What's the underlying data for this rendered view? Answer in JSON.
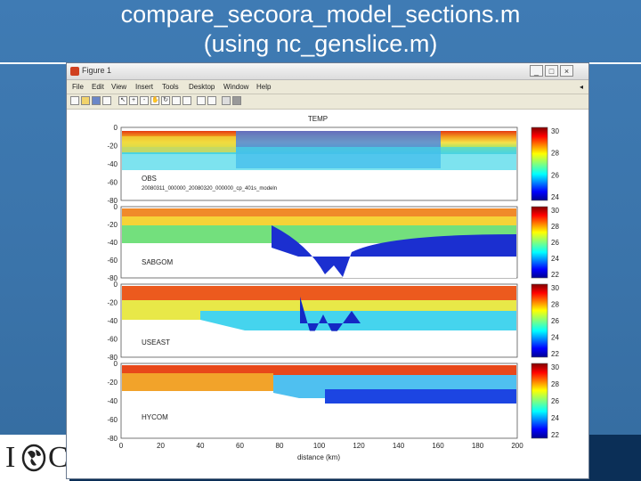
{
  "slide": {
    "title_line1": "compare_secoora_model_sections.m",
    "title_line2": "(using nc_genslice.m)"
  },
  "window": {
    "title": "Figure 1",
    "buttons": [
      "_",
      "□",
      "×"
    ]
  },
  "menu": [
    "File",
    "Edit",
    "View",
    "Insert",
    "Tools",
    "Desktop",
    "Window",
    "Help"
  ],
  "toolbar": [
    "new-icon",
    "open-icon",
    "save-icon",
    "print-icon",
    "pointer-icon",
    "zoom-in-icon",
    "zoom-out-icon",
    "pan-icon",
    "rotate-icon",
    "datacursor-icon",
    "brush-icon",
    "colorbar-icon",
    "legend-icon",
    "grid-icon",
    "plottools-icon"
  ],
  "figure": {
    "plot_title": "TEMP",
    "xlabel": "distance (km)",
    "x_ticks": [
      "0",
      "20",
      "40",
      "60",
      "80",
      "100",
      "120",
      "140",
      "160",
      "180",
      "200"
    ],
    "panels": [
      {
        "label_lines": [
          "OBS",
          "20080311_000000_20080320_000000_cp_401s_modeln"
        ],
        "y_ticks": [
          "0",
          "-20",
          "-40",
          "-60",
          "-80"
        ],
        "cbar_ticks": [
          "30",
          "28",
          "26",
          "24"
        ]
      },
      {
        "label_lines": [
          "SABGOM"
        ],
        "y_ticks": [
          "0",
          "-20",
          "-40",
          "-60",
          "-80"
        ],
        "cbar_ticks": [
          "30",
          "28",
          "26",
          "24",
          "22"
        ]
      },
      {
        "label_lines": [
          "USEAST"
        ],
        "y_ticks": [
          "0",
          "-20",
          "-40",
          "-60",
          "-80"
        ],
        "cbar_ticks": [
          "30",
          "28",
          "26",
          "24",
          "22"
        ]
      },
      {
        "label_lines": [
          "HYCOM"
        ],
        "y_ticks": [
          "0",
          "-20",
          "-40",
          "-60",
          "-80"
        ],
        "cbar_ticks": [
          "30",
          "28",
          "26",
          "24",
          "22"
        ]
      }
    ]
  },
  "colors": {
    "background": "#3f7bb4",
    "footer": "#0b2f57"
  }
}
